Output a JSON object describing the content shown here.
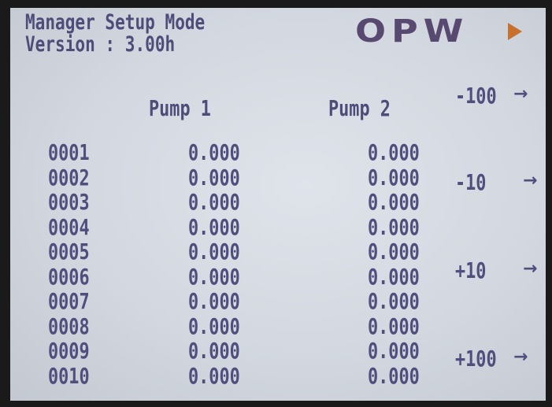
{
  "header": {
    "title": "Manager Setup Mode",
    "version": "Version : 3.00h",
    "logo_text": "OPW"
  },
  "columns": {
    "pump1": "Pump 1",
    "pump2": "Pump 2"
  },
  "rows": [
    {
      "id": "0001",
      "pump1": "0.000",
      "pump2": "0.000"
    },
    {
      "id": "0002",
      "pump1": "0.000",
      "pump2": "0.000"
    },
    {
      "id": "0003",
      "pump1": "0.000",
      "pump2": "0.000"
    },
    {
      "id": "0004",
      "pump1": "0.000",
      "pump2": "0.000"
    },
    {
      "id": "0005",
      "pump1": "0.000",
      "pump2": "0.000"
    },
    {
      "id": "0006",
      "pump1": "0.000",
      "pump2": "0.000"
    },
    {
      "id": "0007",
      "pump1": "0.000",
      "pump2": "0.000"
    },
    {
      "id": "0008",
      "pump1": "0.000",
      "pump2": "0.000"
    },
    {
      "id": "0009",
      "pump1": "0.000",
      "pump2": "0.000"
    },
    {
      "id": "0010",
      "pump1": "0.000",
      "pump2": "0.000"
    }
  ],
  "softkeys": [
    {
      "label": "-100",
      "arrow": "→"
    },
    {
      "label": "-10",
      "arrow": "→"
    },
    {
      "label": "+10",
      "arrow": "→"
    },
    {
      "label": "+100",
      "arrow": "→"
    }
  ],
  "colors": {
    "lcd_text": "#4f4e7d",
    "lcd_background": "#d8dde5",
    "logo": "#57496f",
    "logo_arrow": "#c9702c",
    "bezel": "#1a1a1a"
  }
}
